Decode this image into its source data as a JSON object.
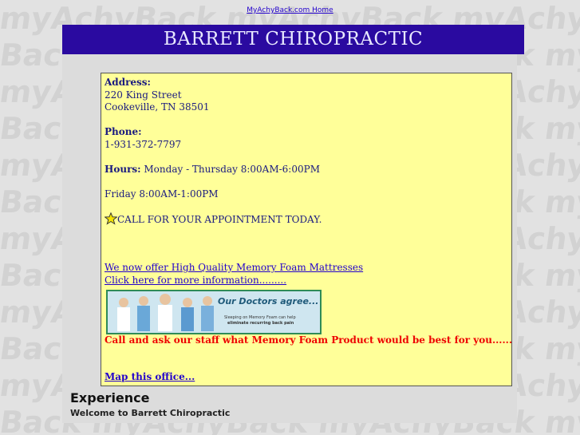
{
  "header": {
    "home_link": "MyAchyBack.com Home",
    "title": "BARRETT CHIROPRACTIC"
  },
  "info": {
    "address_label": "Address:",
    "address_line1": "220 King Street",
    "address_line2": "Cookeville, TN   38501",
    "phone_label": "Phone:",
    "phone": "1-931-372-7797",
    "hours_label": "Hours:",
    "hours_weekday": " Monday - Thursday  8:00AM-6:00PM",
    "hours_friday": "Friday 8:00AM-1:00PM",
    "appointment": "CALL FOR YOUR APPOINTMENT TODAY.",
    "mattress_link": "We now offer High Quality Memory Foam Mattresses ",
    "more_info_link": "Click here for more information......... ",
    "ad_title": "Our Doctors agree...",
    "ad_sub1": "Sleeping on Memory Foam can help",
    "ad_sub2": "eliminate recurring back pain",
    "call_text": "Call and ask our staff what Memory Foam Product would be best for you......",
    "map_link": "Map this office..."
  },
  "experience": {
    "title": "Experience",
    "subtitle": "Welcome to Barrett Chiropractic"
  },
  "colors": {
    "banner": "#2a0aa0",
    "box": "#ffff99",
    "link": "#2200cc",
    "alert": "#ee0000"
  },
  "icons": {
    "star": "star-icon"
  }
}
